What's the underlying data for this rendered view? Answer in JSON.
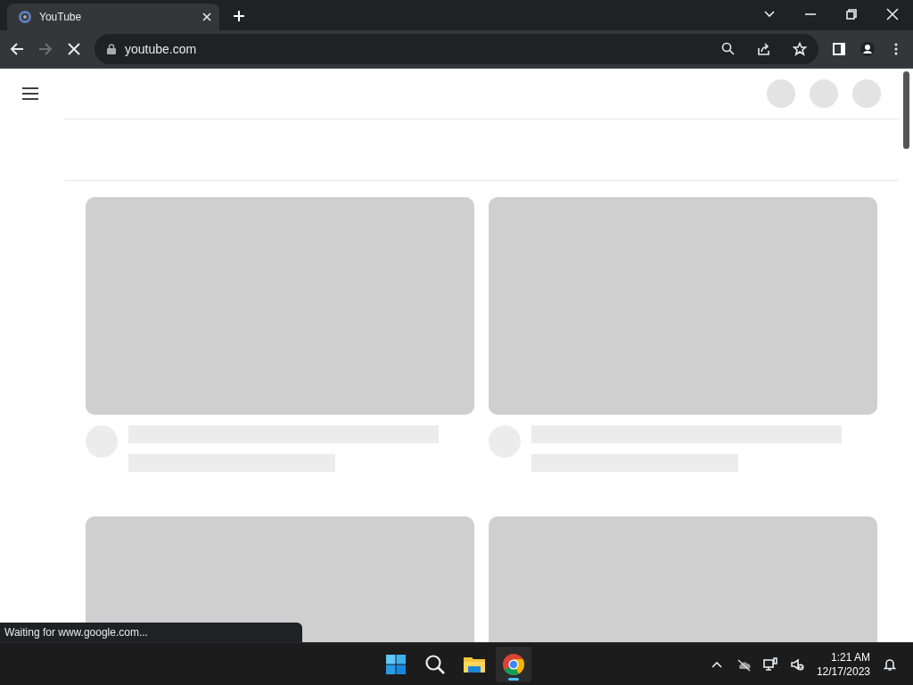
{
  "tabs": [
    {
      "title": "YouTube",
      "selected": true
    }
  ],
  "toolbar": {
    "back_disabled": false,
    "forward_disabled": true,
    "loading": true,
    "address": "youtube.com"
  },
  "page": {
    "loading": true
  },
  "status_bubble": "Waiting for www.google.com...",
  "taskbar": {
    "apps": [
      {
        "kind": "start",
        "active": false
      },
      {
        "kind": "search",
        "active": false
      },
      {
        "kind": "files",
        "active": false
      },
      {
        "kind": "chrome",
        "active": true
      }
    ],
    "time": "1:21 AM",
    "date": "12/17/2023"
  }
}
